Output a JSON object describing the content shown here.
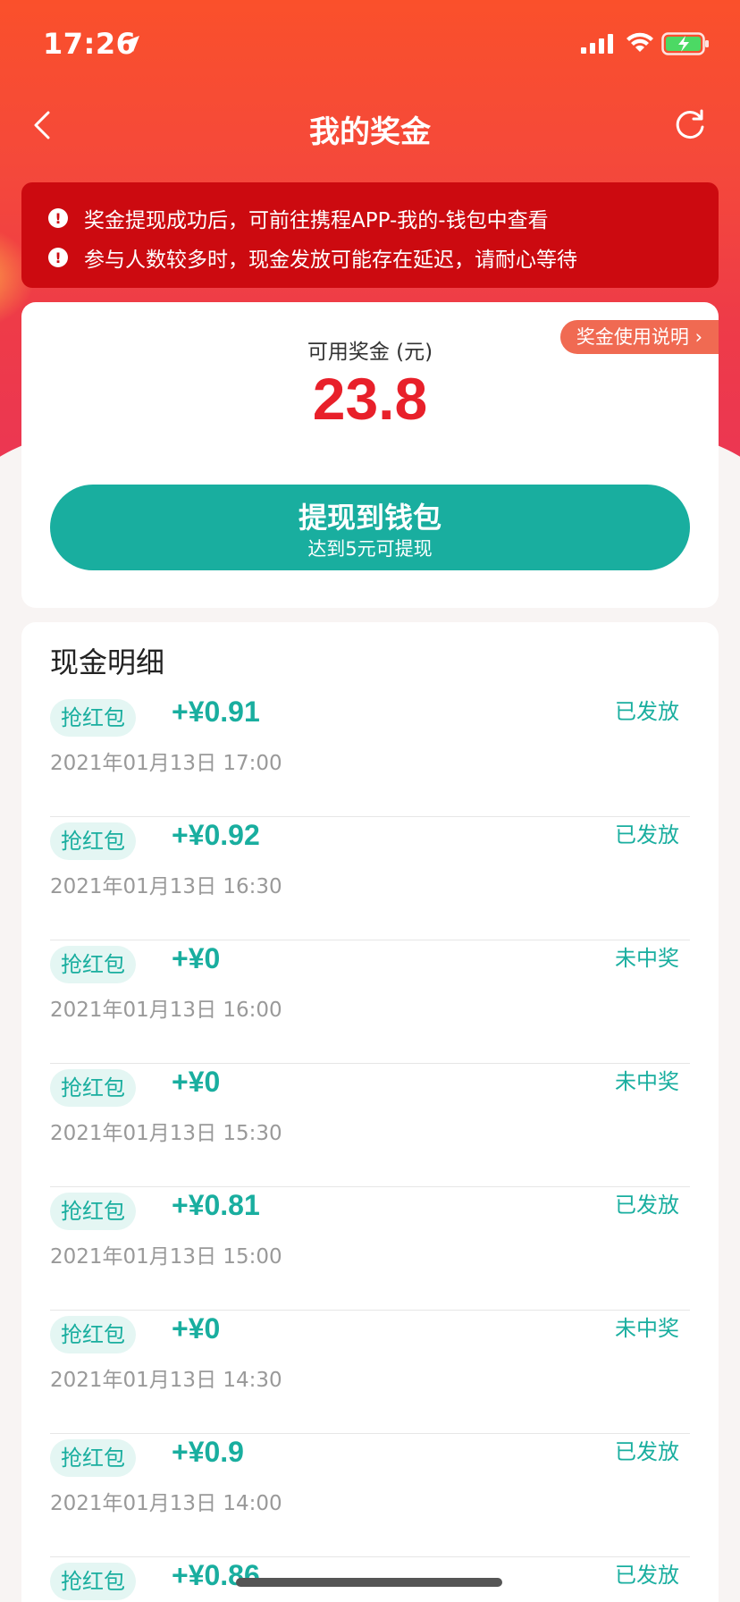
{
  "status_bar": {
    "time": "17:26"
  },
  "nav": {
    "title": "我的奖金"
  },
  "notice": {
    "lines": [
      "奖金提现成功后，可前往携程APP-我的-钱包中查看",
      "参与人数较多时，现金发放可能存在延迟，请耐心等待"
    ]
  },
  "balance": {
    "help_label": "奖金使用说明 ›",
    "label": "可用奖金 (元)",
    "amount": "23.8",
    "withdraw_label": "提现到钱包",
    "withdraw_sub": "达到5元可提现"
  },
  "details": {
    "title": "现金明细",
    "rows": [
      {
        "tag": "抢红包",
        "amount": "+¥0.91",
        "time": "2021年01月13日  17:00",
        "status": "已发放"
      },
      {
        "tag": "抢红包",
        "amount": "+¥0.92",
        "time": "2021年01月13日  16:30",
        "status": "已发放"
      },
      {
        "tag": "抢红包",
        "amount": "+¥0",
        "time": "2021年01月13日  16:00",
        "status": "未中奖"
      },
      {
        "tag": "抢红包",
        "amount": "+¥0",
        "time": "2021年01月13日  15:30",
        "status": "未中奖"
      },
      {
        "tag": "抢红包",
        "amount": "+¥0.81",
        "time": "2021年01月13日  15:00",
        "status": "已发放"
      },
      {
        "tag": "抢红包",
        "amount": "+¥0",
        "time": "2021年01月13日  14:30",
        "status": "未中奖"
      },
      {
        "tag": "抢红包",
        "amount": "+¥0.9",
        "time": "2021年01月13日  14:00",
        "status": "已发放"
      },
      {
        "tag": "抢红包",
        "amount": "+¥0.86",
        "time": "",
        "status": "已发放"
      }
    ]
  },
  "colors": {
    "accent": "#19ae9f",
    "brand": "#fa502b",
    "amount_red": "#e8202a",
    "notice_red": "#cc0a10"
  },
  "icons": [
    "location-arrow-icon",
    "signal-icon",
    "wifi-icon",
    "battery-icon",
    "back-icon",
    "refresh-icon",
    "alert-icon"
  ]
}
